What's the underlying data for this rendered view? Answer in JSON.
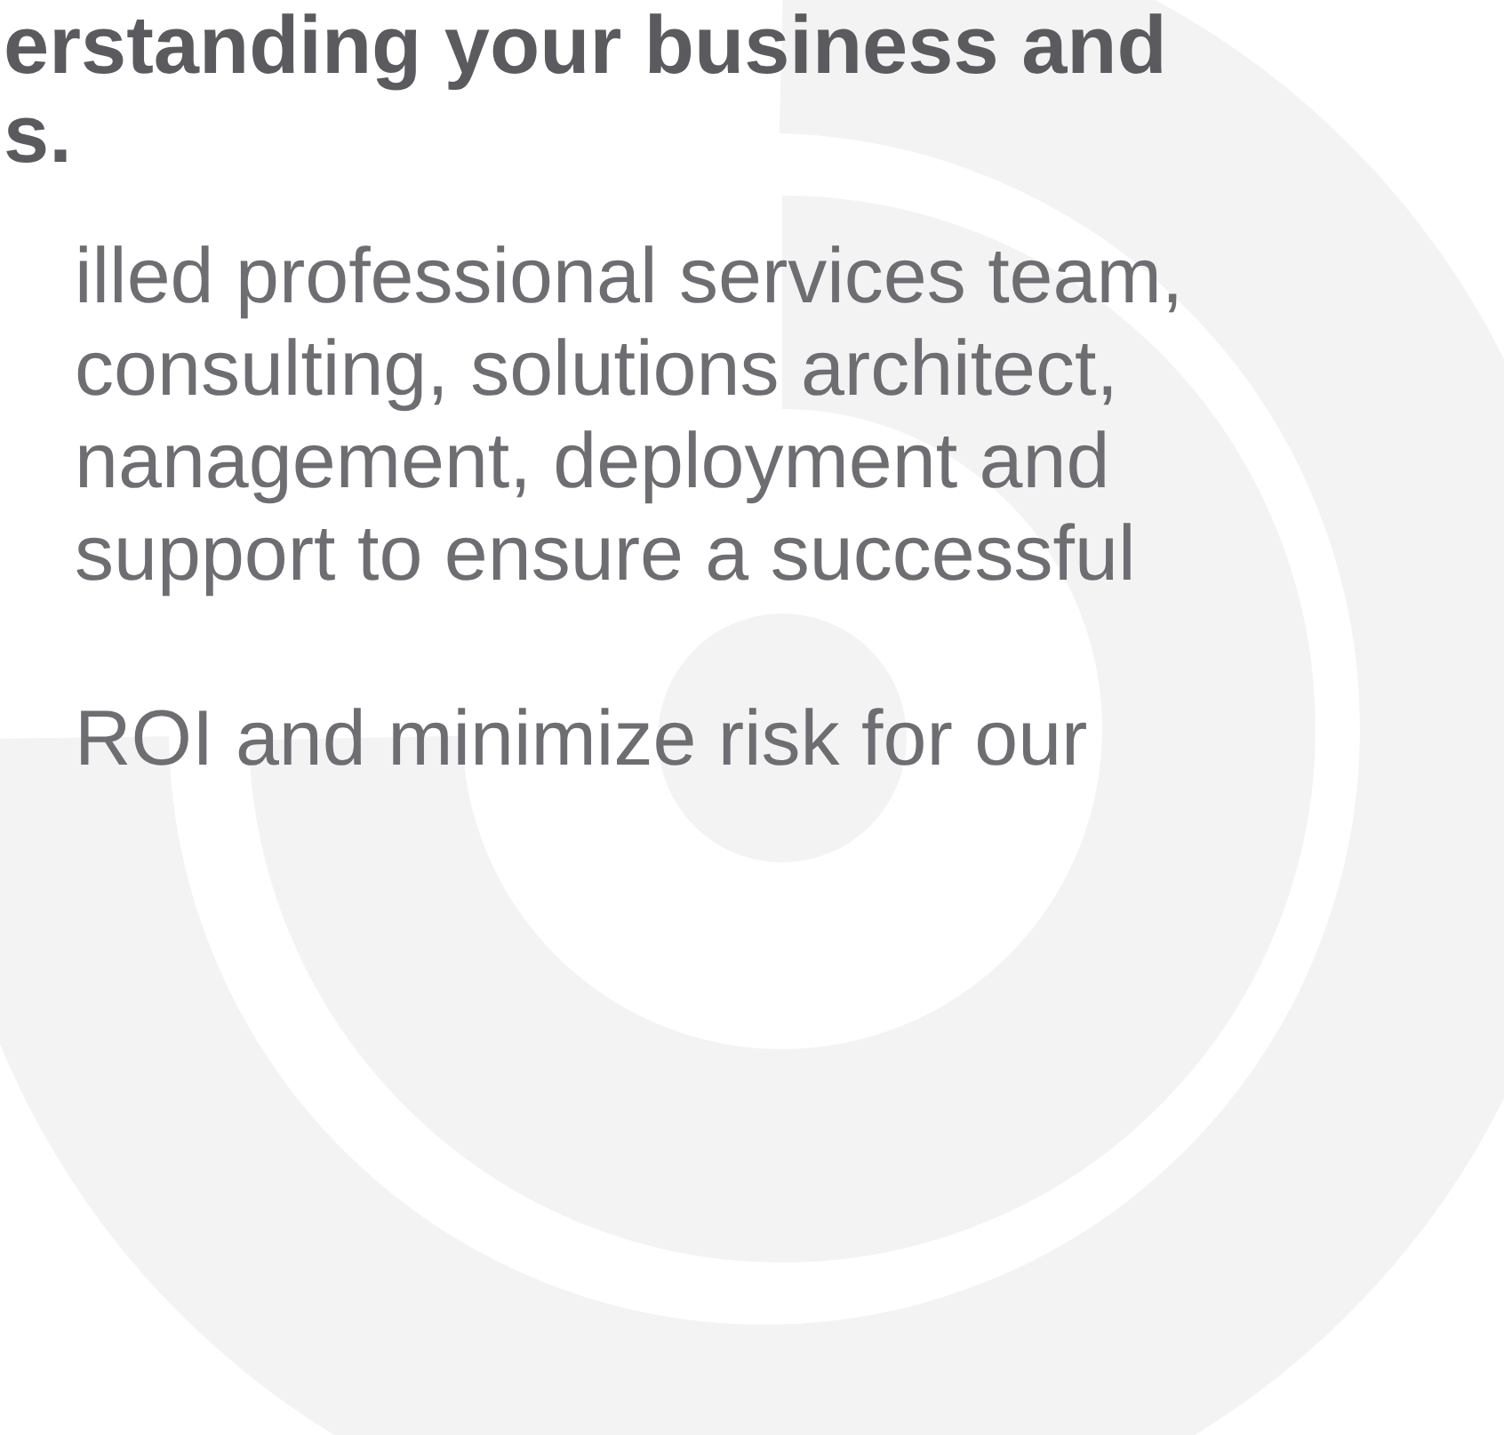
{
  "heading": [
    "erstanding your business and",
    "s."
  ],
  "paragraphs": [
    [
      "illed professional services team,",
      "consulting, solutions architect,",
      "nanagement, deployment and",
      "support to ensure a successful"
    ],
    [
      "ROI and minimize risk for our"
    ]
  ]
}
